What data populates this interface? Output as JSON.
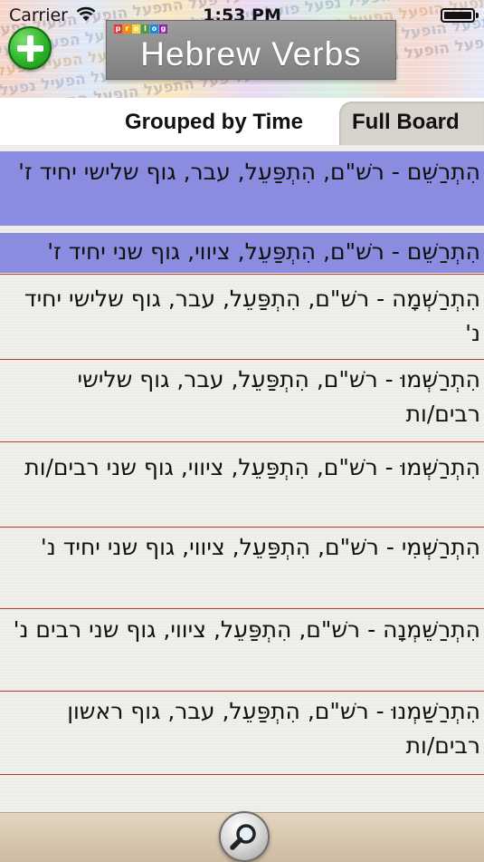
{
  "status_bar": {
    "carrier": "Carrier",
    "time": "1:53 PM"
  },
  "header": {
    "title": "Hebrew Verbs",
    "logo_letters": [
      "p",
      "r",
      "o",
      "l",
      "o",
      "g"
    ],
    "pattern_words": "התפעל הופעל הפעיל נפעל פועל פיעל פעל התפעל הופעל הפעיל נפעל פועל פיעל פעל התפעל"
  },
  "tabs": {
    "grouped": "Grouped by Time",
    "full": "Full Board"
  },
  "list": {
    "items": [
      "הִתְרַשֵּׁם - רשׁ\"ם, הִתְפַּעֵל, עבר, גוף שלישי יחיד ז'",
      "הִתְרַשֵּׁם - רשׁ\"ם, הִתְפַּעֵל, ציווי, גוף שני יחיד ז'",
      "הִתְרַשְּׁמָה - רשׁ\"ם, הִתְפַּעֵל, עבר, גוף שלישי יחיד נ'",
      "הִתְרַשְּׁמוּ - רשׁ\"ם, הִתְפַּעֵל, עבר, גוף שלישי רבים/ות",
      "הִתְרַשְּׁמוּ - רשׁ\"ם, הִתְפַּעֵל, ציווי, גוף שני רבים/ות",
      "הִתְרַשְּׁמִי - רשׁ\"ם, הִתְפַּעֵל, ציווי, גוף שני יחיד נ'",
      "הִתְרַשֵּׁמְנָה - רשׁ\"ם, הִתְפַּעֵל, ציווי, גוף שני רבים נ'",
      "הִתְרַשַּׁמְנוּ - רשׁ\"ם, הִתְפַּעֵל, עבר, גוף ראשון רבים/ות"
    ]
  },
  "colors": {
    "selected_row": "#8a8ce0",
    "row_divider": "#b53a2e",
    "add_button": "#2fb52a"
  },
  "icons": {
    "add": "plus-icon",
    "search": "magnifier-icon",
    "wifi": "wifi-icon",
    "battery": "battery-icon"
  }
}
